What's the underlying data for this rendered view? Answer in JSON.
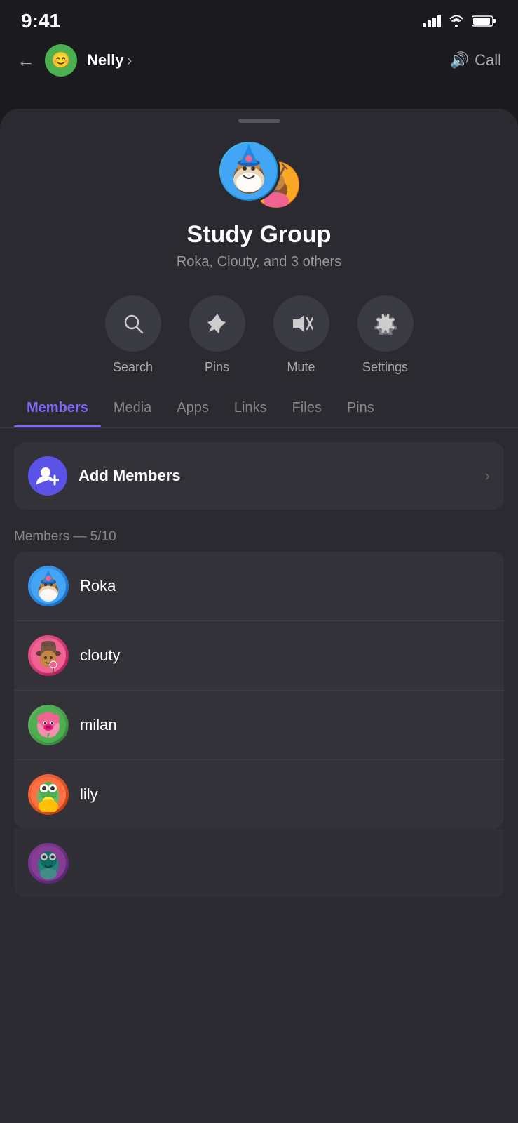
{
  "statusBar": {
    "time": "9:41",
    "signal": "▌▌▌▌",
    "wifi": "wifi",
    "battery": "battery"
  },
  "navBar": {
    "backLabel": "←",
    "contactName": "Nelly",
    "chevron": "›",
    "callLabel": "Call",
    "speakerIcon": "🔊"
  },
  "groupInfo": {
    "name": "Study Group",
    "membersText": "Roka, Clouty, and 3 others",
    "avatarMain": "🧙",
    "avatarSecondary": "🦌"
  },
  "actionButtons": [
    {
      "id": "search",
      "icon": "🔍",
      "label": "Search"
    },
    {
      "id": "pins",
      "icon": "📌",
      "label": "Pins"
    },
    {
      "id": "mute",
      "icon": "🔇",
      "label": "Mute"
    },
    {
      "id": "settings",
      "icon": "⚙️",
      "label": "Settings"
    }
  ],
  "tabs": [
    {
      "id": "members",
      "label": "Members",
      "active": true
    },
    {
      "id": "media",
      "label": "Media",
      "active": false
    },
    {
      "id": "apps",
      "label": "Apps",
      "active": false
    },
    {
      "id": "links",
      "label": "Links",
      "active": false
    },
    {
      "id": "files",
      "label": "Files",
      "active": false
    },
    {
      "id": "pins",
      "label": "Pins",
      "active": false
    }
  ],
  "addMembers": {
    "label": "Add Members",
    "icon": "👤+"
  },
  "membersSection": {
    "countLabel": "Members — 5/10",
    "members": [
      {
        "id": "roka",
        "name": "Roka",
        "avatarClass": "roka",
        "emoji": "🧙"
      },
      {
        "id": "clouty",
        "name": "clouty",
        "avatarClass": "clouty",
        "emoji": "🤠"
      },
      {
        "id": "milan",
        "name": "milan",
        "avatarClass": "milan",
        "emoji": "🐷"
      },
      {
        "id": "lily",
        "name": "lily",
        "avatarClass": "lily",
        "emoji": "🐸"
      },
      {
        "id": "other",
        "name": "",
        "avatarClass": "other",
        "emoji": "🦎"
      }
    ]
  },
  "colors": {
    "accent": "#7c6af7",
    "background": "#2a2a30",
    "card": "#323238",
    "textPrimary": "#ffffff",
    "textSecondary": "#999999"
  }
}
